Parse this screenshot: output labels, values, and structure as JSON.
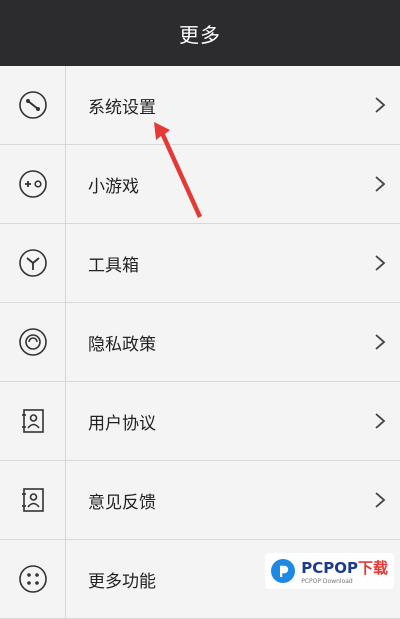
{
  "header": {
    "title": "更多"
  },
  "menu": {
    "items": [
      {
        "label": "系统设置",
        "icon": "wrench-icon"
      },
      {
        "label": "小游戏",
        "icon": "gamepad-icon"
      },
      {
        "label": "工具箱",
        "icon": "tool-y-icon"
      },
      {
        "label": "隐私政策",
        "icon": "privacy-eye-icon"
      },
      {
        "label": "用户协议",
        "icon": "user-card-icon"
      },
      {
        "label": "意见反馈",
        "icon": "feedback-card-icon"
      },
      {
        "label": "更多功能",
        "icon": "more-dots-icon"
      }
    ]
  },
  "watermark": {
    "brand": "PCPOP",
    "suffix": "下载",
    "sub": "PCPOP Download"
  },
  "colors": {
    "header_bg": "#2c2c2e",
    "arrow": "#e53935",
    "row_bg": "#f4f4f4"
  }
}
